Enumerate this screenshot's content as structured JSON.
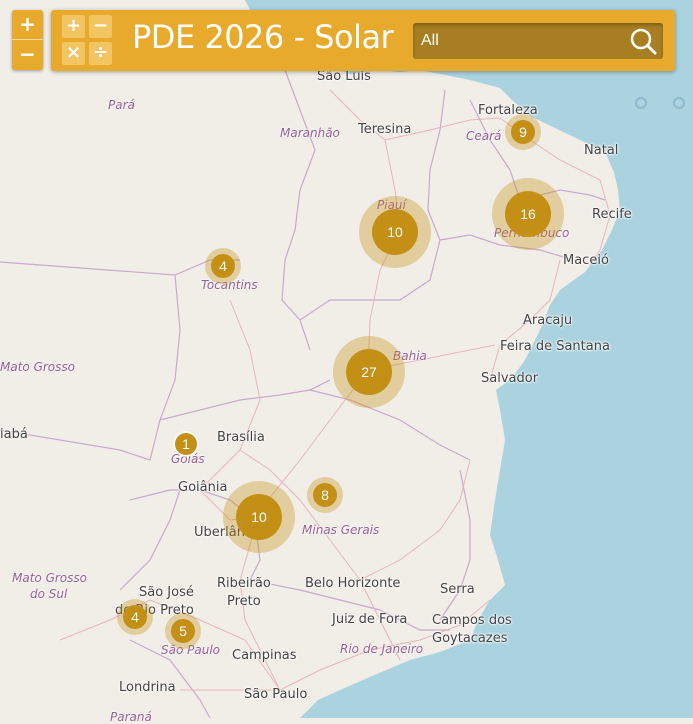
{
  "header": {
    "title": "PDE 2026 - Solar",
    "search_value": "All",
    "search_placeholder": "All"
  },
  "zoom": {
    "in_label": "+",
    "out_label": "−"
  },
  "logo": {
    "plus": "+",
    "minus": "−",
    "times": "×",
    "divide": "÷"
  },
  "colors": {
    "accent": "#e7aa2d",
    "cluster": "#c48f15",
    "cluster_halo": "#e5c38a",
    "sea": "#aad3df",
    "land": "#f1eee8"
  },
  "cities": [
    {
      "id": "sao-luis",
      "name": "São Luís"
    },
    {
      "id": "teresina",
      "name": "Teresina"
    },
    {
      "id": "fortaleza",
      "name": "Fortaleza"
    },
    {
      "id": "natal",
      "name": "Natal"
    },
    {
      "id": "recife",
      "name": "Recife"
    },
    {
      "id": "maceio",
      "name": "Maceió"
    },
    {
      "id": "aracaju",
      "name": "Aracaju"
    },
    {
      "id": "feira",
      "name": "Feira de Santana"
    },
    {
      "id": "salvador",
      "name": "Salvador"
    },
    {
      "id": "brasilia",
      "name": "Brasília"
    },
    {
      "id": "goiania",
      "name": "Goiânia"
    },
    {
      "id": "uberlandia",
      "name": "Uberlândia"
    },
    {
      "id": "ribeirao-1",
      "name": "Ribeirão"
    },
    {
      "id": "ribeirao-2",
      "name": "Preto"
    },
    {
      "id": "sjrp-1",
      "name": "São José"
    },
    {
      "id": "sjrp-2",
      "name": "do Rio Preto"
    },
    {
      "id": "bh",
      "name": "Belo Horizonte"
    },
    {
      "id": "serra",
      "name": "Serra"
    },
    {
      "id": "juiz",
      "name": "Juiz de Fora"
    },
    {
      "id": "campos-1",
      "name": "Campos dos"
    },
    {
      "id": "campos-2",
      "name": "Goytacazes"
    },
    {
      "id": "campinas",
      "name": "Campinas"
    },
    {
      "id": "sao-paulo",
      "name": "São Paulo"
    },
    {
      "id": "londrina",
      "name": "Londrina"
    }
  ],
  "states": [
    {
      "id": "para",
      "name": "Pará"
    },
    {
      "id": "maranhao",
      "name": "Maranhão"
    },
    {
      "id": "ceara",
      "name": "Ceará"
    },
    {
      "id": "piaui",
      "name": "Piauí"
    },
    {
      "id": "pernambuco",
      "name": "Pernambuco"
    },
    {
      "id": "tocantins",
      "name": "Tocantins"
    },
    {
      "id": "mato-grosso",
      "name": "Mato Grosso"
    },
    {
      "id": "bahia",
      "name": "Bahia"
    },
    {
      "id": "goias",
      "name": "Goiás"
    },
    {
      "id": "minas",
      "name": "Minas Gerais"
    },
    {
      "id": "ms-1",
      "name": "Mato Grosso"
    },
    {
      "id": "ms-2",
      "name": "do Sul"
    },
    {
      "id": "sp",
      "name": "São Paulo"
    },
    {
      "id": "rj",
      "name": "Rio de Janeiro"
    }
  ],
  "cuts": [
    {
      "id": "cuiaba",
      "name": "iabá"
    },
    {
      "id": "parana",
      "name": "Paraná"
    }
  ],
  "clusters": [
    {
      "id": "c-9",
      "count": "9",
      "size": "small"
    },
    {
      "id": "c-16",
      "count": "16",
      "size": "large"
    },
    {
      "id": "c-10-piaui",
      "count": "10",
      "size": "large"
    },
    {
      "id": "c-4-tocantins",
      "count": "4",
      "size": "small"
    },
    {
      "id": "c-27",
      "count": "27",
      "size": "large"
    },
    {
      "id": "c-1",
      "count": "1",
      "size": "tiny"
    },
    {
      "id": "c-8",
      "count": "8",
      "size": "small"
    },
    {
      "id": "c-10-minas",
      "count": "10",
      "size": "large"
    },
    {
      "id": "c-4-sp",
      "count": "4",
      "size": "small"
    },
    {
      "id": "c-5",
      "count": "5",
      "size": "small"
    }
  ]
}
